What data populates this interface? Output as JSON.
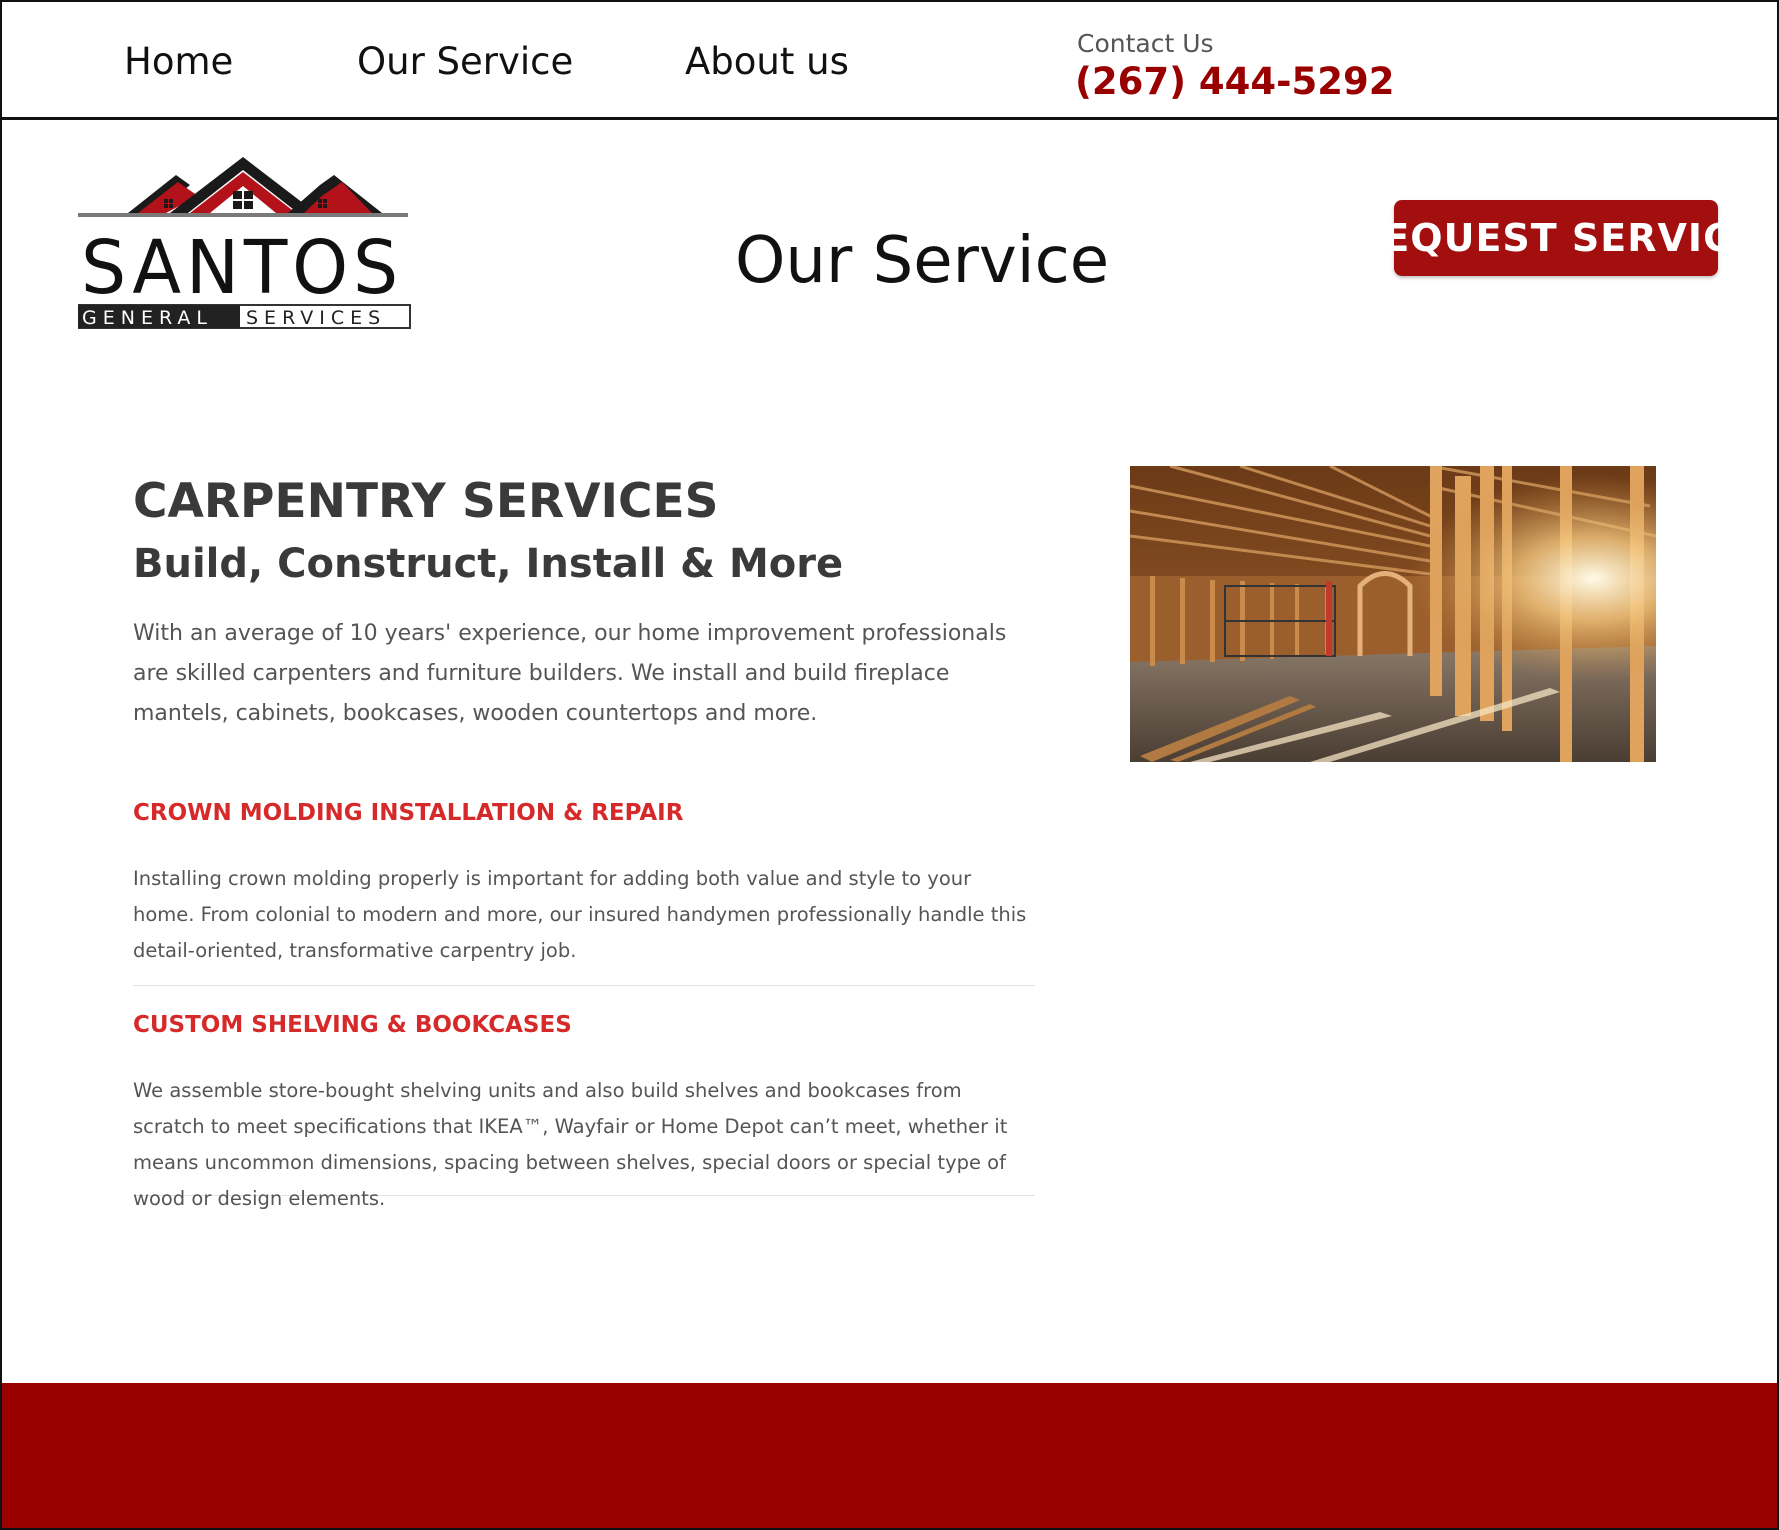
{
  "nav": {
    "home": "Home",
    "service": "Our Service",
    "about": "About us",
    "contact_label": "Contact Us",
    "contact_phone": "(267) 444-5292"
  },
  "logo": {
    "name": "SANTOS",
    "tagline_left": "GENERAL",
    "tagline_right": "SERVICES"
  },
  "header": {
    "title": "Our Service",
    "request_button": "REQUEST SERVICE"
  },
  "content": {
    "title": "CARPENTRY SERVICES",
    "subtitle": "Build, Construct, Install & More",
    "intro": "With an average of 10 years' experience, our home improvement professionals are skilled carpenters and furniture builders. We install and build fireplace mantels, cabinets, bookcases, wooden countertops and more.",
    "services": [
      {
        "heading": "CROWN MOLDING INSTALLATION & REPAIR",
        "text": "Installing crown molding properly is important for adding both value and style to your home. From colonial to modern and more, our insured handymen professionally handle this detail-oriented, transformative carpentry job."
      },
      {
        "heading": "CUSTOM SHELVING & BOOKCASES",
        "text": "We assemble store-bought shelving units and also build shelves and bookcases from scratch to meet specifications that IKEA™, Wayfair or Home Depot can’t meet, whether it means uncommon dimensions, spacing between shelves, special doors or special type of wood or design elements."
      }
    ]
  },
  "colors": {
    "brand_red": "#990000",
    "button_red": "#a30f0f",
    "heading_red": "#d62a2a",
    "text_gray": "#555555"
  },
  "icons": {
    "logo_roof": "house-roof-icon",
    "photo": "construction-framing-photo"
  }
}
